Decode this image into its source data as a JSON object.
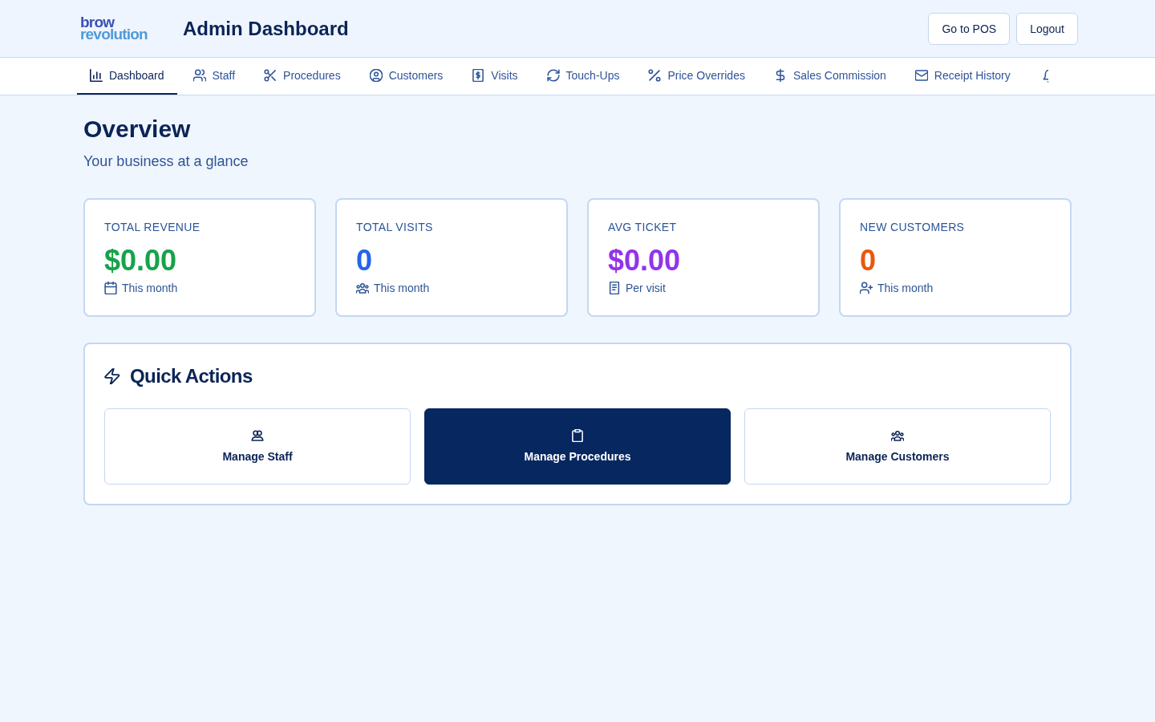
{
  "header": {
    "logo": {
      "line_1": "brow",
      "line_2": "revolution"
    },
    "title": "Admin Dashboard",
    "buttons": [
      "Go to POS",
      "Logout"
    ]
  },
  "nav": {
    "tabs": [
      {
        "label": "Dashboard",
        "selected": true
      },
      {
        "label": "Staff",
        "selected": false
      },
      {
        "label": "Procedures",
        "selected": false
      },
      {
        "label": "Customers",
        "selected": false
      },
      {
        "label": "Visits",
        "selected": false
      },
      {
        "label": "Touch-Ups",
        "selected": false
      },
      {
        "label": "Price Overrides",
        "selected": false
      },
      {
        "label": "Sales Commission",
        "selected": false
      },
      {
        "label": "Receipt History",
        "selected": false
      }
    ]
  },
  "overview": {
    "title": "Overview",
    "subtitle": "Your business at a glance"
  },
  "stats": [
    {
      "label": "TOTAL REVENUE",
      "value": "$0.00",
      "color": "#16a34a",
      "note": "This month"
    },
    {
      "label": "TOTAL VISITS",
      "value": "0",
      "color": "#2563eb",
      "note": "This month"
    },
    {
      "label": "AVG TICKET",
      "value": "$0.00",
      "color": "#9333ea",
      "note": "Per visit"
    },
    {
      "label": "NEW CUSTOMERS",
      "value": "0",
      "color": "#ea580c",
      "note": "This month"
    }
  ],
  "quick_actions": {
    "title": "Quick Actions",
    "actions": [
      {
        "label": "Manage Staff",
        "highlighted": false
      },
      {
        "label": "Manage Procedures",
        "highlighted": true
      },
      {
        "label": "Manage Customers",
        "highlighted": false
      }
    ]
  }
}
